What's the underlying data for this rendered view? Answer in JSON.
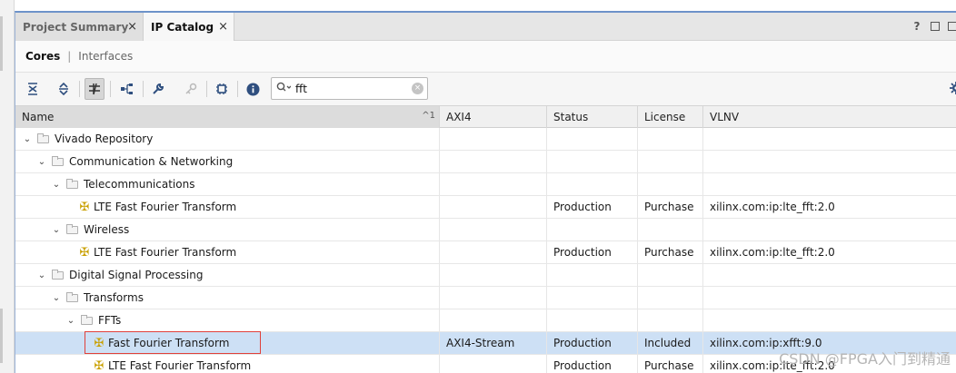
{
  "tabs": [
    {
      "label": "Project Summary",
      "close": "×"
    },
    {
      "label": "IP Catalog",
      "close": "×"
    }
  ],
  "window_controls": {
    "help": "?"
  },
  "subtabs": {
    "cores": "Cores",
    "separator": "|",
    "interfaces": "Interfaces"
  },
  "search": {
    "value": "fft",
    "clear": "×"
  },
  "columns": {
    "name": "Name",
    "sort": "^1",
    "axi4": "AXI4",
    "status": "Status",
    "license": "License",
    "vlnv": "VLNV"
  },
  "rows": [
    {
      "name": "Vivado Repository",
      "axi4": "",
      "status": "",
      "license": "",
      "vlnv": ""
    },
    {
      "name": "Communication & Networking",
      "axi4": "",
      "status": "",
      "license": "",
      "vlnv": ""
    },
    {
      "name": "Telecommunications",
      "axi4": "",
      "status": "",
      "license": "",
      "vlnv": ""
    },
    {
      "name": "LTE Fast Fourier Transform",
      "axi4": "",
      "status": "Production",
      "license": "Purchase",
      "vlnv": "xilinx.com:ip:lte_fft:2.0"
    },
    {
      "name": "Wireless",
      "axi4": "",
      "status": "",
      "license": "",
      "vlnv": ""
    },
    {
      "name": "LTE Fast Fourier Transform",
      "axi4": "",
      "status": "Production",
      "license": "Purchase",
      "vlnv": "xilinx.com:ip:lte_fft:2.0"
    },
    {
      "name": "Digital Signal Processing",
      "axi4": "",
      "status": "",
      "license": "",
      "vlnv": ""
    },
    {
      "name": "Transforms",
      "axi4": "",
      "status": "",
      "license": "",
      "vlnv": ""
    },
    {
      "name": "FFTs",
      "axi4": "",
      "status": "",
      "license": "",
      "vlnv": ""
    },
    {
      "name": "Fast Fourier Transform",
      "axi4": "AXI4-Stream",
      "status": "Production",
      "license": "Included",
      "vlnv": "xilinx.com:ip:xfft:9.0"
    },
    {
      "name": "LTE Fast Fourier Transform",
      "axi4": "",
      "status": "Production",
      "license": "Purchase",
      "vlnv": "xilinx.com:ip:lte_fft:2.0"
    }
  ],
  "watermark": "CSDN @FPGA入门到精通"
}
